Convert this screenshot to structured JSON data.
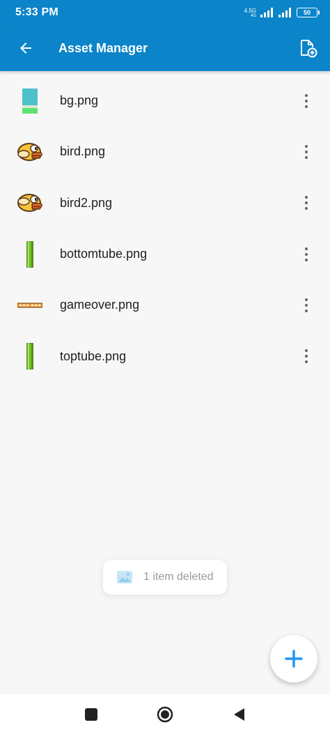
{
  "status_bar": {
    "time": "5:33 PM",
    "network_label": "4.5G",
    "network_sub": "4G",
    "battery": "50"
  },
  "app_bar": {
    "title": "Asset Manager",
    "back_icon": "arrow-back-icon",
    "action_icon": "add-file-icon"
  },
  "assets": [
    {
      "name": "bg.png",
      "thumb": "bg"
    },
    {
      "name": "bird.png",
      "thumb": "bird"
    },
    {
      "name": "bird2.png",
      "thumb": "bird"
    },
    {
      "name": "bottomtube.png",
      "thumb": "tube"
    },
    {
      "name": "gameover.png",
      "thumb": "gameover"
    },
    {
      "name": "toptube.png",
      "thumb": "tube"
    }
  ],
  "toast": {
    "text": "1 item deleted",
    "icon": "image-icon"
  },
  "fab": {
    "icon": "plus-icon"
  },
  "nav": {
    "recents_icon": "square-icon",
    "home_icon": "circle-icon",
    "back_icon": "triangle-back-icon"
  },
  "colors": {
    "primary": "#0b84c9",
    "fab_icon": "#2196f3"
  }
}
